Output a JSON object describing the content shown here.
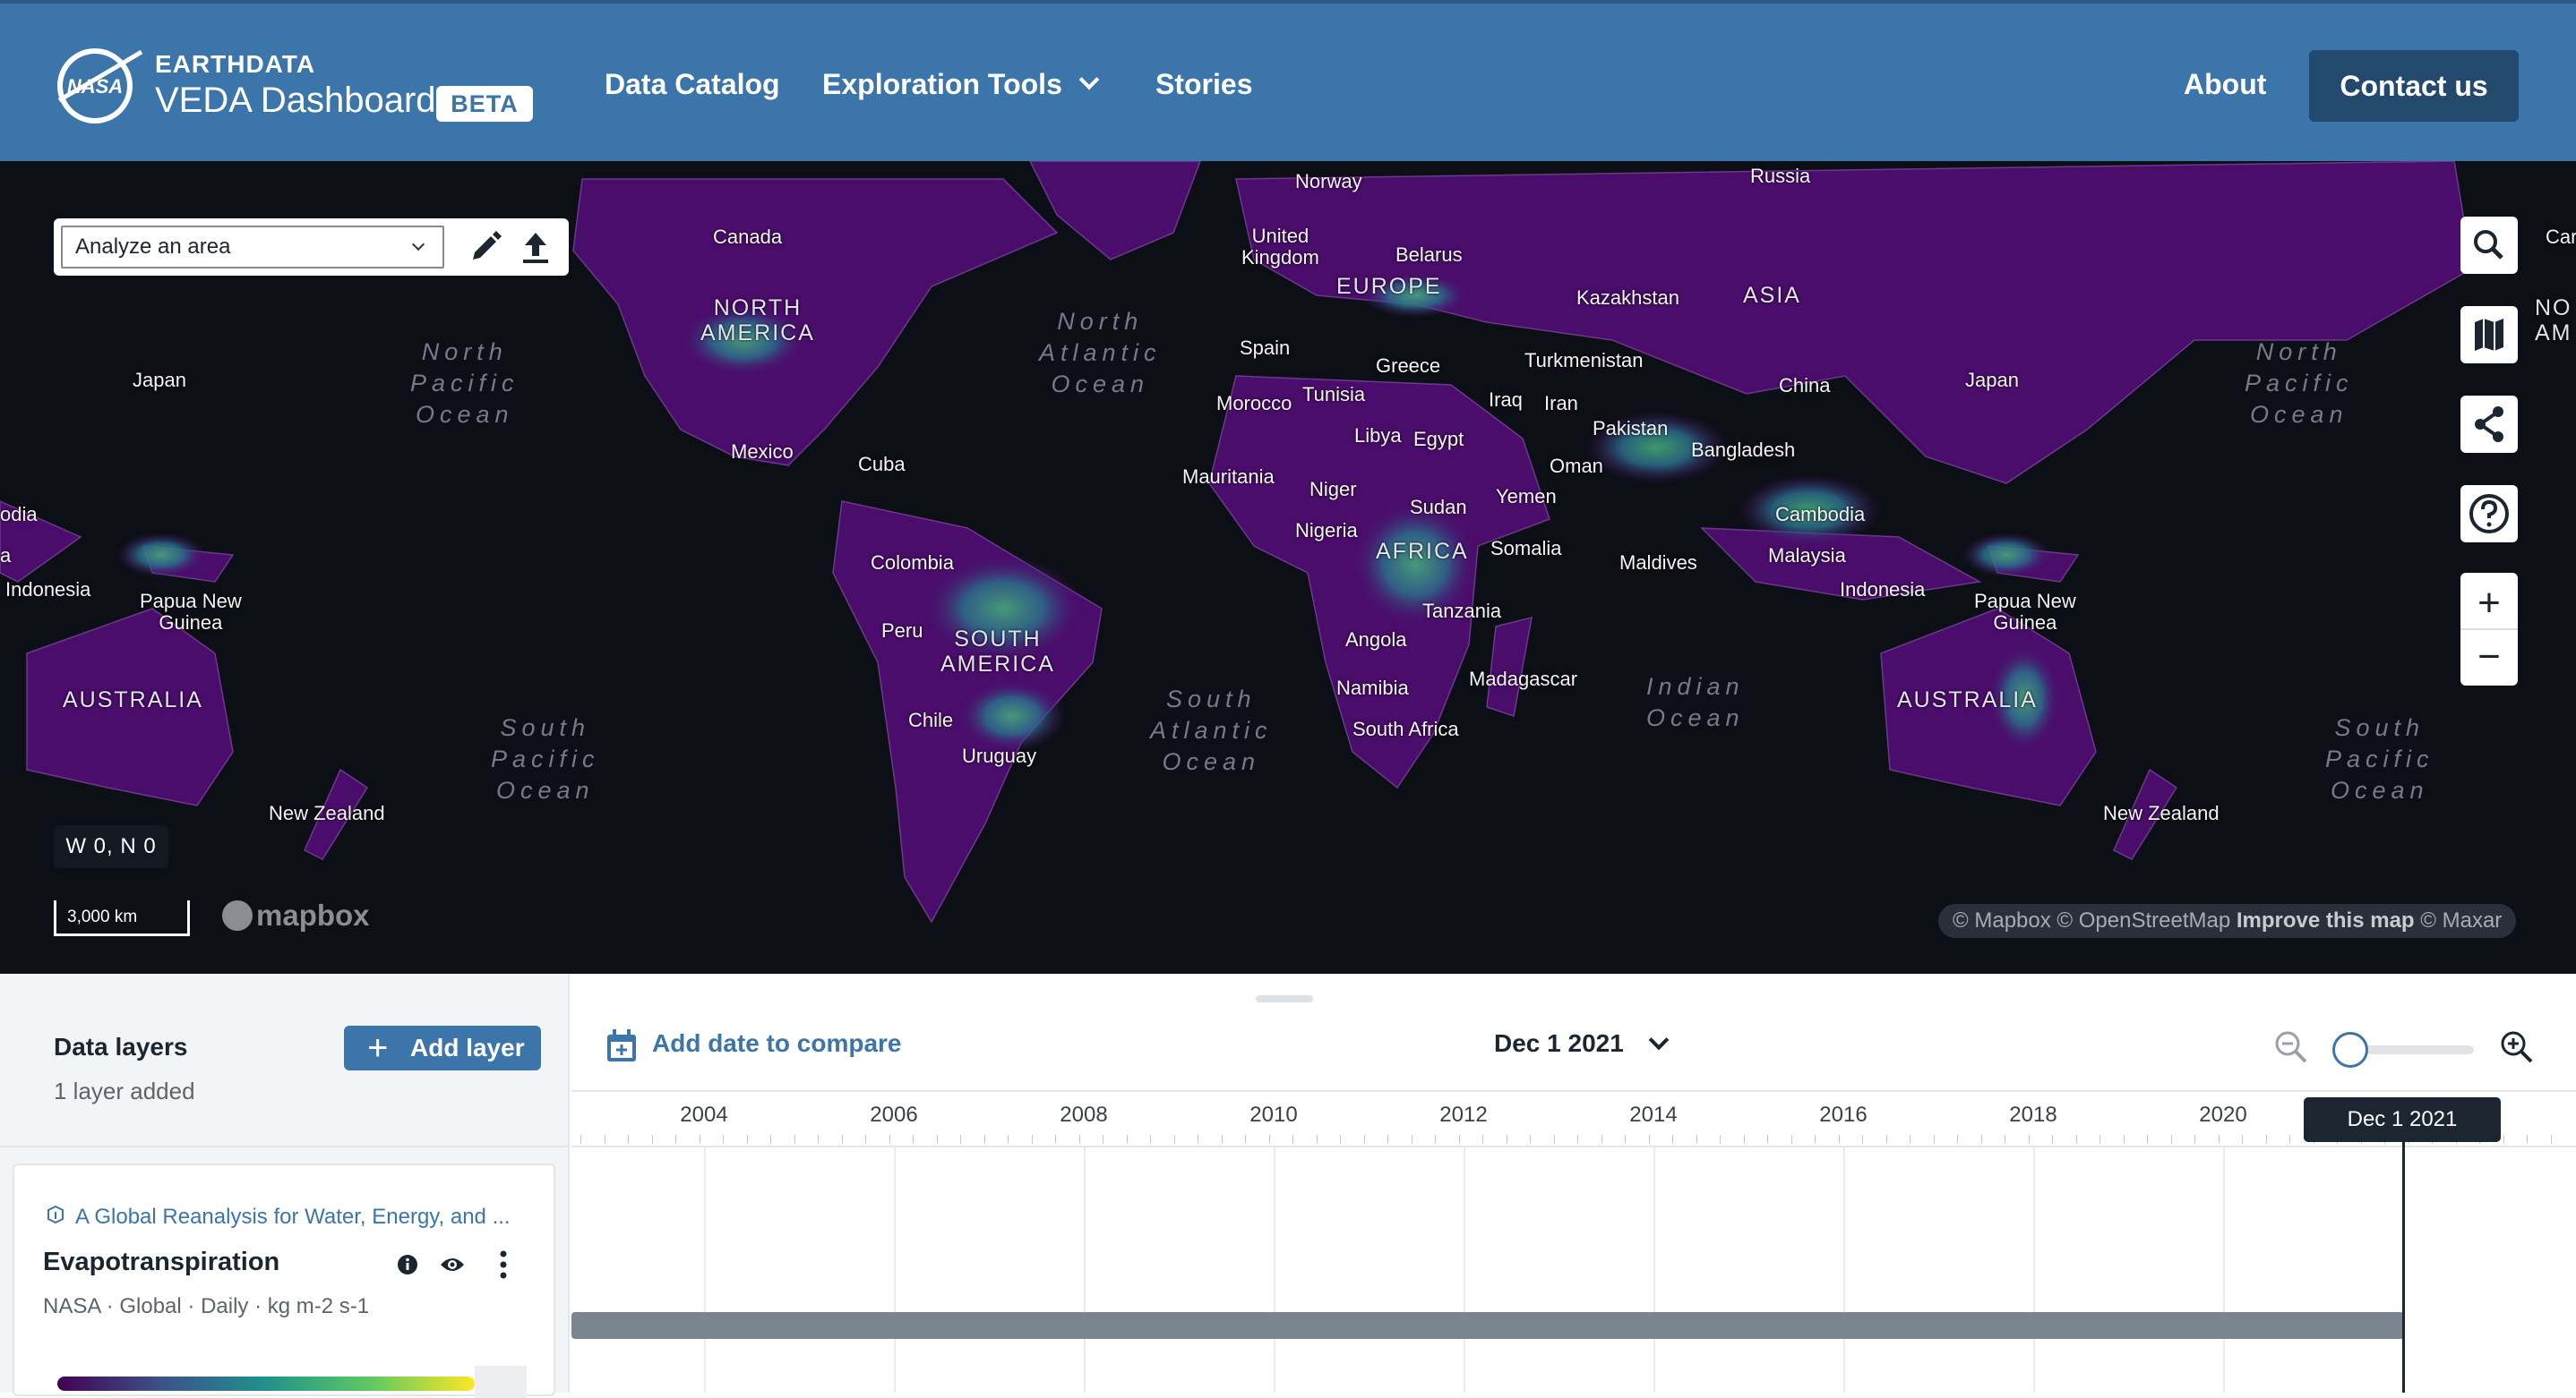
{
  "header": {
    "brand_top": "EARTHDATA",
    "brand_main": "VEDA Dashboard",
    "badge": "BETA",
    "logo_text": "NASA",
    "nav": {
      "data_catalog": "Data Catalog",
      "exploration_tools": "Exploration Tools",
      "stories": "Stories",
      "about": "About",
      "contact": "Contact us"
    }
  },
  "map": {
    "analyze_select": "Analyze an area",
    "coords": "W 0, N 0",
    "scale": "3,000 km",
    "mapbox_logo": "mapbox",
    "attribution": {
      "mapbox": "© Mapbox",
      "osm": "© OpenStreetMap",
      "improve": "Improve this map",
      "maxar": "© Maxar"
    },
    "labels": {
      "norway": "Norway",
      "russia": "Russia",
      "canada": "Canada",
      "canada_edge": "Car",
      "united_kingdom": "United\nKingdom",
      "belarus": "Belarus",
      "north_america": "NORTH\nAMERICA",
      "north_america_edge": "NO\nAM",
      "europe": "EUROPE",
      "kazakhstan": "Kazakhstan",
      "asia": "ASIA",
      "north_atlantic": "North\nAtlantic\nOcean",
      "north_pacific_w": "North\nPacific\nOcean",
      "north_pacific_e": "North\nPacific\nOcean",
      "japan_w": "Japan",
      "japan_e": "Japan",
      "spain": "Spain",
      "greece": "Greece",
      "turkmenistan": "Turkmenistan",
      "china": "China",
      "morocco": "Morocco",
      "tunisia": "Tunisia",
      "iraq": "Iraq",
      "iran": "Iran",
      "libya": "Libya",
      "egypt": "Egypt",
      "pakistan": "Pakistan",
      "mexico": "Mexico",
      "cuba": "Cuba",
      "bangladesh": "Bangladesh",
      "oman": "Oman",
      "mauritania": "Mauritania",
      "niger": "Niger",
      "sudan": "Sudan",
      "yemen": "Yemen",
      "nigeria": "Nigeria",
      "cambodia": "Cambodia",
      "colombia": "Colombia",
      "africa": "AFRICA",
      "somalia": "Somalia",
      "maldives": "Maldives",
      "malaysia": "Malaysia",
      "bodia_edge": "odia",
      "a_edge": "a",
      "indonesia_w": "Indonesia",
      "indonesia_e": "Indonesia",
      "png_w": "Papua New\nGuinea",
      "png_e": "Papua New\nGuinea",
      "tanzania": "Tanzania",
      "peru": "Peru",
      "south_america": "SOUTH\nAMERICA",
      "angola": "Angola",
      "australia_w": "AUSTRALIA",
      "australia_e": "AUSTRALIA",
      "namibia": "Namibia",
      "madagascar": "Madagascar",
      "south_atlantic": "South\nAtlantic\nOcean",
      "indian_ocean": "Indian\nOcean",
      "chile": "Chile",
      "south_africa": "South Africa",
      "south_pacific_w": "South\nPacific\nOcean",
      "south_pacific_e": "South\nPacific\nOcean",
      "uruguay": "Uruguay",
      "new_zealand_w": "New Zealand",
      "new_zealand_e": "New Zealand"
    }
  },
  "panel": {
    "title": "Data layers",
    "subtitle": "1 layer added",
    "add_layer": "Add layer",
    "layer": {
      "dataset": "A Global Reanalysis for Water, Energy, and ...",
      "name": "Evapotranspiration",
      "meta": "NASA · Global · Daily · kg m-2 s-1"
    }
  },
  "timeline": {
    "add_date": "Add date to compare",
    "selected_date": "Dec 1 2021",
    "cursor_label": "Dec 1 2021",
    "years": [
      "2004",
      "2006",
      "2008",
      "2010",
      "2012",
      "2014",
      "2016",
      "2018",
      "2020"
    ],
    "zoom_level": 0
  },
  "colors": {
    "header_bg": "#3b75aa",
    "contact_bg": "#24496f",
    "map_bg": "#0d0f16",
    "land": "#4a0d6b",
    "accent": "#3b75aa"
  }
}
